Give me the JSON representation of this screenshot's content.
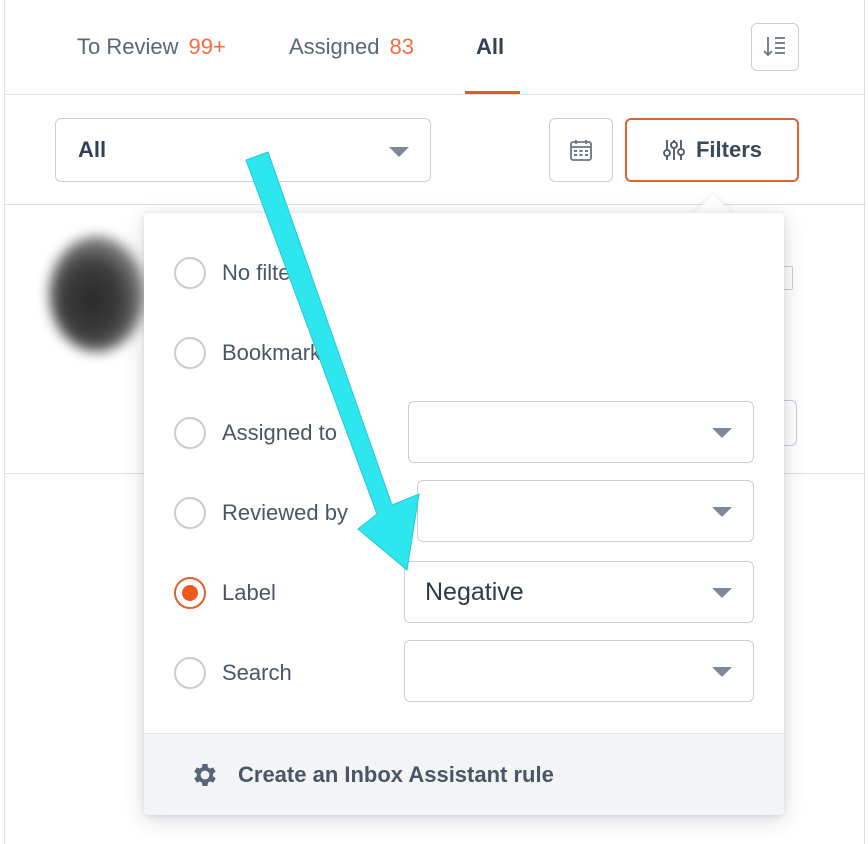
{
  "tabs": [
    {
      "label": "To Review",
      "count": "99+"
    },
    {
      "label": "Assigned",
      "count": "83"
    },
    {
      "label": "All",
      "count": ""
    }
  ],
  "toolbar": {
    "view_select_value": "All",
    "filters_label": "Filters"
  },
  "filters_popover": {
    "options": [
      {
        "label": "No filter",
        "selected": false
      },
      {
        "label": "Bookmarks",
        "selected": false
      },
      {
        "label": "Assigned to",
        "selected": false,
        "dropdown_value": ""
      },
      {
        "label": "Reviewed by",
        "selected": false,
        "dropdown_value": ""
      },
      {
        "label": "Label",
        "selected": true,
        "dropdown_value": "Negative"
      },
      {
        "label": "Search",
        "selected": false,
        "dropdown_value": ""
      }
    ],
    "footer_label": "Create an Inbox Assistant rule"
  },
  "icons": {
    "sort": "sort-lines-icon",
    "calendar": "calendar-icon",
    "filters": "sliders-icon",
    "footer": "gear-icon"
  },
  "colors": {
    "accent": "#e0622a",
    "count": "#f26f3d",
    "annotation_arrow": "#2ee6ee"
  }
}
